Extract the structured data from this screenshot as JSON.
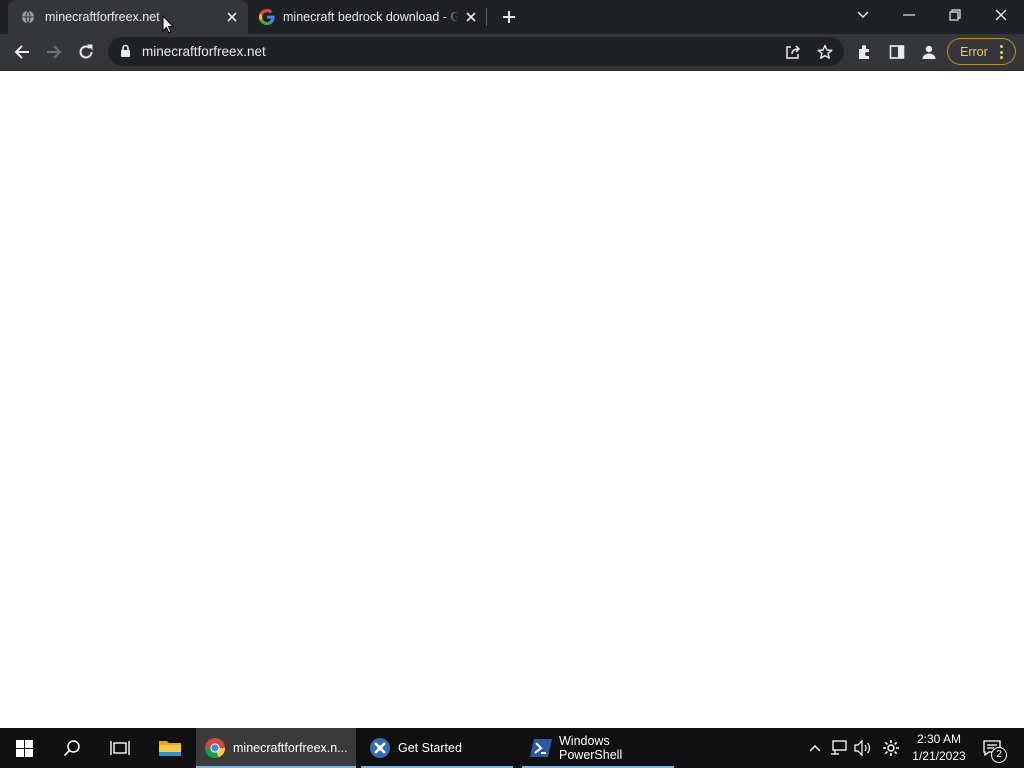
{
  "browser": {
    "tabs": [
      {
        "title": "minecraftforfreex.net",
        "active": true,
        "favicon": "globe-icon"
      },
      {
        "title": "minecraft bedrock download - Google Search",
        "active": false,
        "favicon": "google-g-icon"
      }
    ],
    "url": "minecraftforfreex.net",
    "profile_error_label": "Error",
    "colors": {
      "frame": "#202124",
      "toolbar": "#35363a",
      "error_accent": "#f0c868"
    }
  },
  "taskbar": {
    "apps": [
      {
        "label": "minecraftforfreex.n...",
        "icon": "chrome-icon",
        "active": true
      },
      {
        "label": "Get Started",
        "icon": "get-started-icon",
        "active": false
      },
      {
        "label": "Windows PowerShell",
        "icon": "powershell-icon",
        "active": false
      }
    ],
    "clock": {
      "time": "2:30 AM",
      "date": "1/21/2023"
    },
    "notification_count": "2"
  }
}
